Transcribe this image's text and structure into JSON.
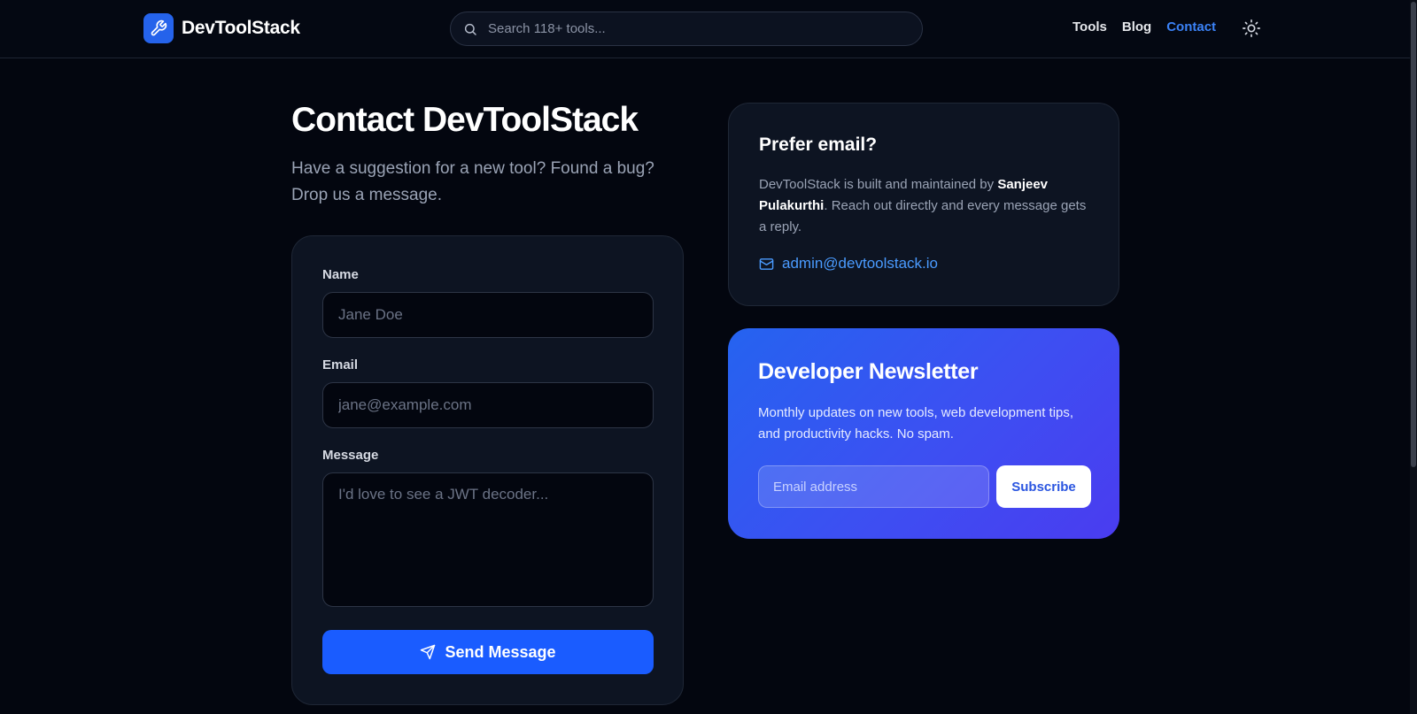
{
  "header": {
    "brand": "DevToolStack",
    "search_placeholder": "Search 118+ tools...",
    "nav": [
      {
        "label": "Tools"
      },
      {
        "label": "Blog"
      },
      {
        "label": "Contact",
        "active": true
      }
    ],
    "icons": {
      "logo": "wrench-icon",
      "search": "search-icon",
      "theme": "sun-icon"
    }
  },
  "main": {
    "title": "Contact DevToolStack",
    "subtitle": "Have a suggestion for a new tool? Found a bug? Drop us a message.",
    "form": {
      "name_label": "Name",
      "name_placeholder": "Jane Doe",
      "email_label": "Email",
      "email_placeholder": "jane@example.com",
      "message_label": "Message",
      "message_placeholder": "I'd love to see a JWT decoder...",
      "submit_label": "Send Message"
    }
  },
  "email_card": {
    "title": "Prefer email?",
    "text_before": "DevToolStack is built and maintained by ",
    "author": "Sanjeev Pulakurthi",
    "text_after": ". Reach out directly and every message gets a reply.",
    "email": "admin@devtoolstack.io"
  },
  "newsletter": {
    "title": "Developer Newsletter",
    "text": "Monthly updates on new tools, web development tips, and productivity hacks. No spam.",
    "input_placeholder": "Email address",
    "button_label": "Subscribe"
  },
  "colors": {
    "accent": "#1a5cff",
    "link": "#4a9bff",
    "background": "#03060f",
    "card": "#0d1422"
  }
}
